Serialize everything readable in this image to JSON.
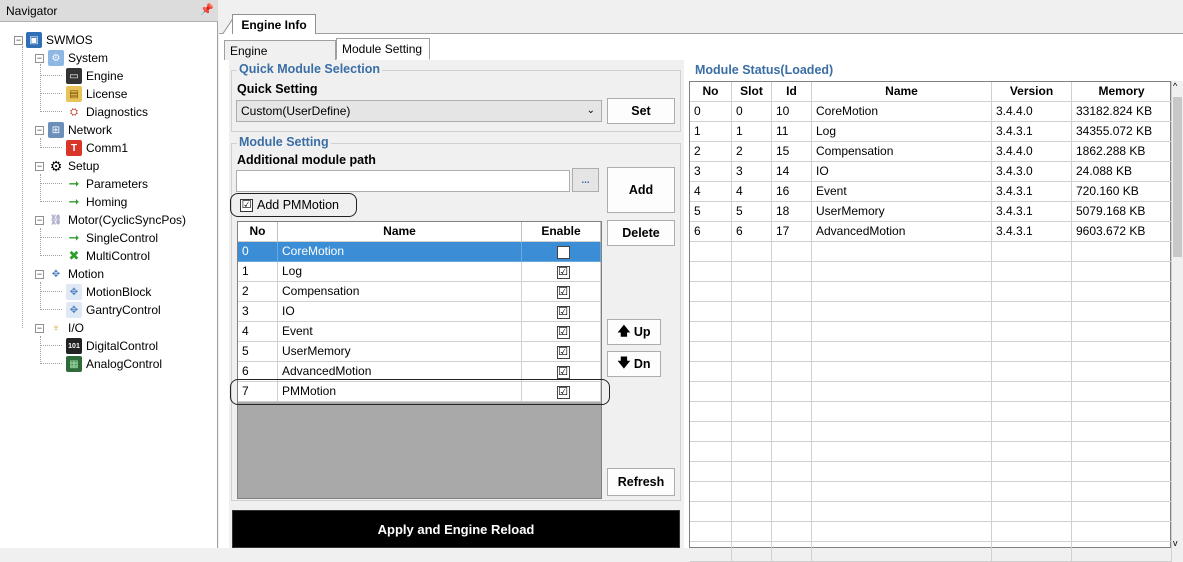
{
  "navigator": {
    "title": "Navigator",
    "pin": "↕",
    "tree": {
      "root": "SWMOS",
      "system": "System",
      "engine": "Engine",
      "license": "License",
      "diagnostics": "Diagnostics",
      "network": "Network",
      "comm1": "Comm1",
      "setup": "Setup",
      "parameters": "Parameters",
      "homing": "Homing",
      "motor": "Motor(CyclicSyncPos)",
      "single_control": "SingleControl",
      "multi_control": "MultiControl",
      "motion": "Motion",
      "motion_block": "MotionBlock",
      "gantry_control": "GantryControl",
      "io": "I/O",
      "digital_control": "DigitalControl",
      "analog_control": "AnalogControl"
    }
  },
  "tabs": {
    "engine_info": "Engine Info",
    "engine_information": "Engine Information",
    "module_setting": "Module Setting"
  },
  "quick": {
    "group_title": "Quick Module Selection",
    "label": "Quick Setting",
    "selected": "Custom(UserDefine)",
    "set_button": "Set"
  },
  "module_setting": {
    "group_title": "Module Setting",
    "path_label": "Additional module path",
    "path_value": "",
    "browse_button": "...",
    "add_button": "Add",
    "add_pm_label": "Add PMMotion",
    "add_pm_checked": "☑",
    "delete_button": "Delete",
    "up_button": "Up",
    "down_button": "Dn",
    "refresh_button": "Refresh",
    "columns": {
      "no": "No",
      "name": "Name",
      "enable": "Enable"
    },
    "rows": [
      {
        "no": "0",
        "name": "CoreMotion",
        "enable": "☑"
      },
      {
        "no": "1",
        "name": "Log",
        "enable": "☑"
      },
      {
        "no": "2",
        "name": "Compensation",
        "enable": "☑"
      },
      {
        "no": "3",
        "name": "IO",
        "enable": "☑"
      },
      {
        "no": "4",
        "name": "Event",
        "enable": "☑"
      },
      {
        "no": "5",
        "name": "UserMemory",
        "enable": "☑"
      },
      {
        "no": "6",
        "name": "AdvancedMotion",
        "enable": "☑"
      },
      {
        "no": "7",
        "name": "PMMotion",
        "enable": "☑"
      }
    ]
  },
  "apply_button": "Apply and Engine Reload",
  "status": {
    "title": "Module Status(Loaded)",
    "columns": {
      "no": "No",
      "slot": "Slot",
      "id": "Id",
      "name": "Name",
      "version": "Version",
      "memory": "Memory"
    },
    "rows": [
      {
        "no": "0",
        "slot": "0",
        "id": "10",
        "name": "CoreMotion",
        "version": "3.4.4.0",
        "memory": "33182.824 KB"
      },
      {
        "no": "1",
        "slot": "1",
        "id": "11",
        "name": "Log",
        "version": "3.4.3.1",
        "memory": "34355.072 KB"
      },
      {
        "no": "2",
        "slot": "2",
        "id": "15",
        "name": "Compensation",
        "version": "3.4.4.0",
        "memory": "1862.288 KB"
      },
      {
        "no": "3",
        "slot": "3",
        "id": "14",
        "name": "IO",
        "version": "3.4.3.0",
        "memory": "24.088 KB"
      },
      {
        "no": "4",
        "slot": "4",
        "id": "16",
        "name": "Event",
        "version": "3.4.3.1",
        "memory": "720.160 KB"
      },
      {
        "no": "5",
        "slot": "5",
        "id": "18",
        "name": "UserMemory",
        "version": "3.4.3.1",
        "memory": "5079.168 KB"
      },
      {
        "no": "6",
        "slot": "6",
        "id": "17",
        "name": "AdvancedMotion",
        "version": "3.4.3.1",
        "memory": "9603.672 KB"
      }
    ]
  },
  "colors": {
    "accent": "#3a6ea5",
    "selection": "#3b8ed5"
  }
}
